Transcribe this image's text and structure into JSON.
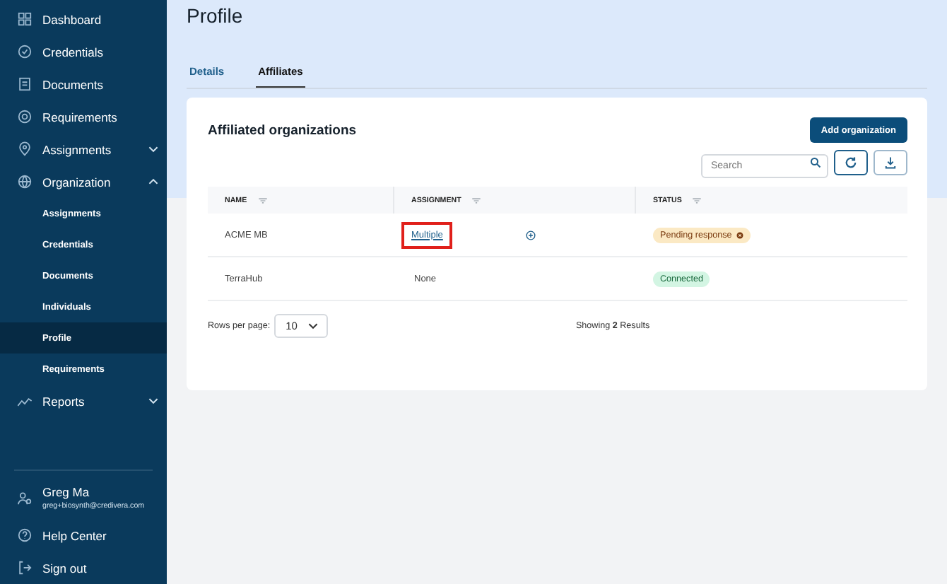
{
  "sidebar": {
    "items": [
      {
        "label": "Dashboard",
        "selected": false
      },
      {
        "label": "Credentials",
        "selected": false
      },
      {
        "label": "Documents",
        "selected": false
      },
      {
        "label": "Requirements",
        "selected": false
      },
      {
        "label": "Assignments",
        "selected": false,
        "expanded": false
      },
      {
        "label": "Organization",
        "selected": false,
        "expanded": true,
        "children": [
          {
            "label": "Assignments",
            "selected": false
          },
          {
            "label": "Credentials",
            "selected": false
          },
          {
            "label": "Documents",
            "selected": false
          },
          {
            "label": "Individuals",
            "selected": false
          },
          {
            "label": "Profile",
            "selected": true
          },
          {
            "label": "Requirements",
            "selected": false
          }
        ]
      },
      {
        "label": "Reports",
        "selected": false,
        "expanded": false
      }
    ],
    "user": {
      "name": "Greg Ma",
      "email": "greg+biosynth@credivera.com"
    },
    "footer": [
      {
        "label": "Help Center"
      },
      {
        "label": "Sign out"
      }
    ]
  },
  "page_title": "Profile",
  "tabs": [
    {
      "label": "Details",
      "selected": false
    },
    {
      "label": "Affiliates",
      "selected": true
    }
  ],
  "card": {
    "title": "Affiliated organizations",
    "add_button": "Add organization",
    "search": {
      "placeholder": "Search"
    },
    "table": {
      "columns": [
        "NAME",
        "ASSIGNMENT",
        "STATUS"
      ],
      "rows": [
        {
          "name": "ACME MB",
          "assignment": "Multiple",
          "kind": "link",
          "highlighted": true,
          "add_icon": true,
          "status": "Pending response",
          "color": "#fbe9c4",
          "removable": true
        },
        {
          "name": "TerraHub",
          "assignment": "None",
          "kind": "text",
          "highlighted": false,
          "add_icon": false,
          "status": "Connected",
          "color": "#d3f5e3",
          "removable": false
        }
      ]
    },
    "rows_per_page_label": "Rows per page:",
    "rows_per_page": "10",
    "results": "Showing **2** Results"
  }
}
